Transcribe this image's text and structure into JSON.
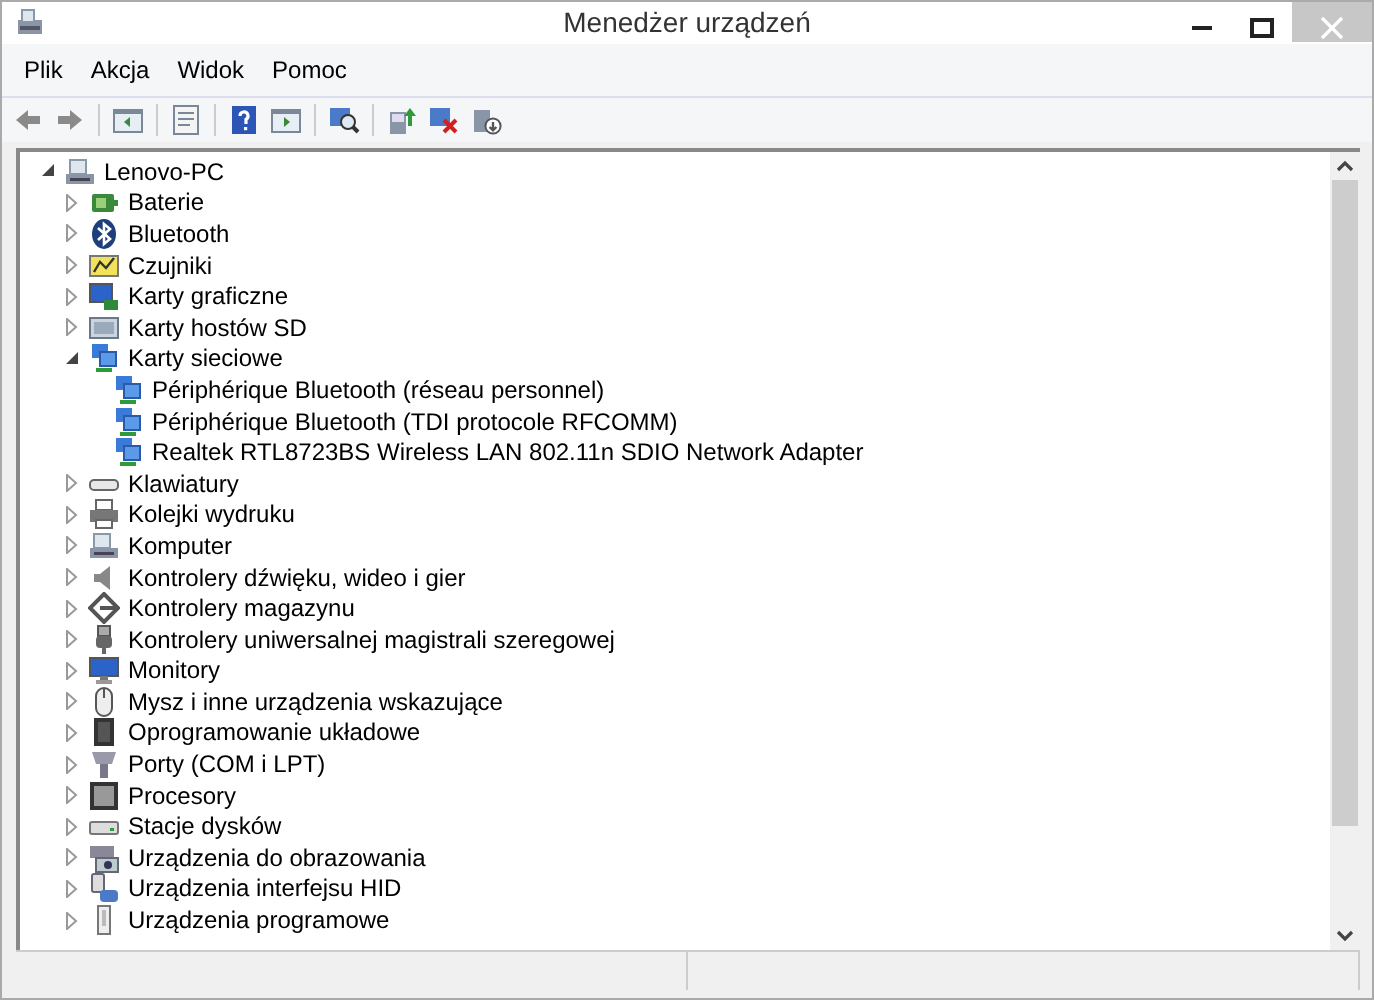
{
  "window": {
    "title": "Menedżer urządzeń"
  },
  "menu": [
    "Plik",
    "Akcja",
    "Widok",
    "Pomoc"
  ],
  "toolbar": [
    {
      "kind": "back"
    },
    {
      "kind": "forward"
    },
    {
      "kind": "sep"
    },
    {
      "kind": "panel"
    },
    {
      "kind": "sep"
    },
    {
      "kind": "properties"
    },
    {
      "kind": "sep"
    },
    {
      "kind": "help"
    },
    {
      "kind": "panel2"
    },
    {
      "kind": "sep"
    },
    {
      "kind": "scan"
    },
    {
      "kind": "sep"
    },
    {
      "kind": "update"
    },
    {
      "kind": "remove"
    },
    {
      "kind": "disable"
    }
  ],
  "tree": {
    "label": "Lenovo-PC",
    "expanded": true,
    "children": [
      {
        "label": "Baterie",
        "expanded": false
      },
      {
        "label": "Bluetooth",
        "expanded": false
      },
      {
        "label": "Czujniki",
        "expanded": false
      },
      {
        "label": "Karty graficzne",
        "expanded": false
      },
      {
        "label": "Karty hostów SD",
        "expanded": false
      },
      {
        "label": "Karty sieciowe",
        "expanded": true,
        "children": [
          {
            "label": "Périphérique Bluetooth (réseau personnel)"
          },
          {
            "label": "Périphérique Bluetooth (TDI protocole RFCOMM)"
          },
          {
            "label": "Realtek RTL8723BS Wireless LAN 802.11n SDIO Network Adapter"
          }
        ]
      },
      {
        "label": "Klawiatury",
        "expanded": false
      },
      {
        "label": "Kolejki wydruku",
        "expanded": false
      },
      {
        "label": "Komputer",
        "expanded": false
      },
      {
        "label": "Kontrolery dźwięku, wideo i gier",
        "expanded": false
      },
      {
        "label": "Kontrolery magazynu",
        "expanded": false
      },
      {
        "label": "Kontrolery uniwersalnej magistrali szeregowej",
        "expanded": false
      },
      {
        "label": "Monitory",
        "expanded": false
      },
      {
        "label": "Mysz i inne urządzenia wskazujące",
        "expanded": false
      },
      {
        "label": "Oprogramowanie układowe",
        "expanded": false
      },
      {
        "label": "Porty (COM i LPT)",
        "expanded": false
      },
      {
        "label": "Procesory",
        "expanded": false
      },
      {
        "label": "Stacje dysków",
        "expanded": false
      },
      {
        "label": "Urządzenia do obrazowania",
        "expanded": false
      },
      {
        "label": "Urządzenia interfejsu HID",
        "expanded": false
      },
      {
        "label": "Urządzenia programowe",
        "expanded": false
      }
    ]
  }
}
